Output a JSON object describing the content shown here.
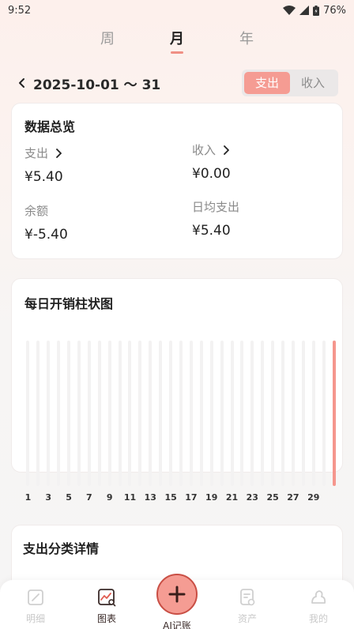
{
  "status_bar": {
    "time": "9:52",
    "battery": "76%"
  },
  "period_tabs": [
    {
      "label": "周",
      "active": false
    },
    {
      "label": "月",
      "active": true
    },
    {
      "label": "年",
      "active": false
    }
  ],
  "date_range": "2025-10-01 〜 31",
  "type_toggle": {
    "expense": "支出",
    "income": "收入",
    "selected": "expense"
  },
  "overview": {
    "title": "数据总览",
    "expense_label": "支出",
    "expense_value": "¥5.40",
    "income_label": "收入",
    "income_value": "¥0.00",
    "balance_label": "余额",
    "balance_value": "¥-5.40",
    "daily_avg_label": "日均支出",
    "daily_avg_value": "¥5.40"
  },
  "chart_data": {
    "type": "bar",
    "title": "每日开销柱状图",
    "categories": [
      "1",
      "2",
      "3",
      "4",
      "5",
      "6",
      "7",
      "8",
      "9",
      "10",
      "11",
      "12",
      "13",
      "14",
      "15",
      "16",
      "17",
      "18",
      "19",
      "20",
      "21",
      "22",
      "23",
      "24",
      "25",
      "26",
      "27",
      "28",
      "29",
      "30",
      "31"
    ],
    "values": [
      0,
      0,
      0,
      0,
      0,
      0,
      0,
      0,
      0,
      0,
      0,
      0,
      0,
      0,
      0,
      0,
      0,
      0,
      0,
      0,
      0,
      0,
      0,
      0,
      0,
      0,
      0,
      0,
      0,
      0,
      5.4
    ],
    "tick_labels": [
      "1",
      "3",
      "5",
      "7",
      "9",
      "11",
      "13",
      "15",
      "17",
      "19",
      "21",
      "23",
      "25",
      "27",
      "29"
    ],
    "ylim": [
      0,
      5.4
    ],
    "grid": false,
    "colors": {
      "bar": "#f5968d",
      "track": "#f3f2f2"
    }
  },
  "category_section": {
    "title": "支出分类详情"
  },
  "bottom_nav": {
    "items": [
      {
        "label": "明细",
        "icon": "edit-note-icon"
      },
      {
        "label": "图表",
        "icon": "chart-search-icon"
      },
      {
        "label": "资产",
        "icon": "asset-icon"
      },
      {
        "label": "我的",
        "icon": "profile-icon"
      }
    ],
    "fab_label": "AI记账",
    "active_index": 1
  },
  "colors": {
    "accent": "#f59c93",
    "accent_dark": "#c94f45"
  }
}
